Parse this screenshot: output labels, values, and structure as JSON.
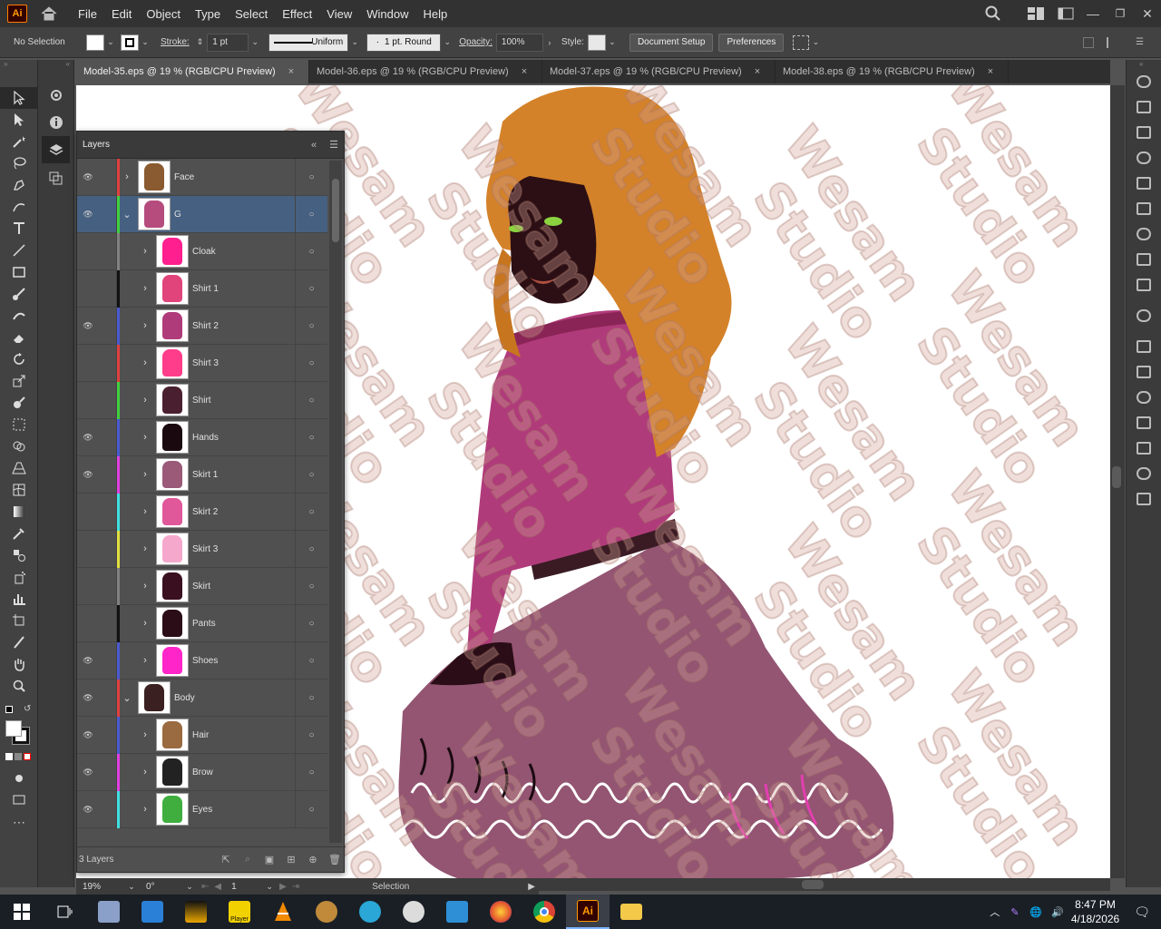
{
  "app": {
    "logo": "Ai",
    "menus": [
      "File",
      "Edit",
      "Object",
      "Type",
      "Select",
      "Effect",
      "View",
      "Window",
      "Help"
    ]
  },
  "control": {
    "selection": "No Selection",
    "stroke_label": "Stroke:",
    "stroke_value": "1 pt",
    "profile": "Uniform",
    "brush": "1 pt. Round",
    "opacity_label": "Opacity:",
    "opacity_value": "100%",
    "style_label": "Style:",
    "doc_setup": "Document Setup",
    "preferences": "Preferences"
  },
  "tabs": [
    {
      "label": "Model-35.eps @ 19 % (RGB/CPU Preview)",
      "close": "×"
    },
    {
      "label": "Model-36.eps @ 19 % (RGB/CPU Preview)",
      "close": "×"
    },
    {
      "label": "Model-37.eps @ 19 % (RGB/CPU Preview)",
      "close": "×"
    },
    {
      "label": "Model-38.eps @ 19 % (RGB/CPU Preview)",
      "close": "×"
    }
  ],
  "layers_panel": {
    "title": "Layers",
    "footer_count": "3 Layers",
    "rows": [
      {
        "name": "Face",
        "color": "#e04040",
        "visible": true,
        "expanded": false,
        "indent": 0,
        "selected": false
      },
      {
        "name": "G",
        "color": "#40d040",
        "visible": true,
        "expanded": true,
        "indent": 0,
        "selected": true
      },
      {
        "name": "Cloak",
        "color": "#808080",
        "visible": false,
        "expanded": false,
        "indent": 1,
        "selected": false
      },
      {
        "name": "Shirt 1",
        "color": "#111111",
        "visible": false,
        "expanded": false,
        "indent": 1,
        "selected": false
      },
      {
        "name": "Shirt 2",
        "color": "#4a5ad0",
        "visible": true,
        "expanded": false,
        "indent": 1,
        "selected": false
      },
      {
        "name": "Shirt 3",
        "color": "#e04040",
        "visible": false,
        "expanded": false,
        "indent": 1,
        "selected": false
      },
      {
        "name": "Shirt",
        "color": "#40d040",
        "visible": false,
        "expanded": false,
        "indent": 1,
        "selected": false
      },
      {
        "name": "Hands",
        "color": "#4a5ad0",
        "visible": true,
        "expanded": false,
        "indent": 1,
        "selected": false
      },
      {
        "name": "Skirt 1",
        "color": "#e040e0",
        "visible": true,
        "expanded": false,
        "indent": 1,
        "selected": false
      },
      {
        "name": "Skirt 2",
        "color": "#40e0e0",
        "visible": false,
        "expanded": false,
        "indent": 1,
        "selected": false
      },
      {
        "name": "Skirt 3",
        "color": "#e0e040",
        "visible": false,
        "expanded": false,
        "indent": 1,
        "selected": false
      },
      {
        "name": "Skirt",
        "color": "#808080",
        "visible": false,
        "expanded": false,
        "indent": 1,
        "selected": false
      },
      {
        "name": "Pants",
        "color": "#111111",
        "visible": false,
        "expanded": false,
        "indent": 1,
        "selected": false
      },
      {
        "name": "Shoes",
        "color": "#4a5ad0",
        "visible": true,
        "expanded": false,
        "indent": 1,
        "selected": false
      },
      {
        "name": "Body",
        "color": "#e04040",
        "visible": true,
        "expanded": true,
        "indent": 0,
        "selected": false
      },
      {
        "name": "Hair",
        "color": "#4a5ad0",
        "visible": true,
        "expanded": false,
        "indent": 1,
        "selected": false
      },
      {
        "name": "Brow",
        "color": "#e040e0",
        "visible": true,
        "expanded": false,
        "indent": 1,
        "selected": false
      },
      {
        "name": "Eyes",
        "color": "#40e0e0",
        "visible": true,
        "expanded": false,
        "indent": 1,
        "selected": false
      }
    ]
  },
  "status": {
    "zoom": "19%",
    "rotate": "0°",
    "artboard": "1",
    "tool": "Selection"
  },
  "watermark": {
    "line1": "Wesam",
    "line2": "Studio"
  },
  "taskbar": {
    "time": "8:47 PM",
    "date": "4/18/2026",
    "player_label": "Player",
    "ai_label": "Ai"
  }
}
